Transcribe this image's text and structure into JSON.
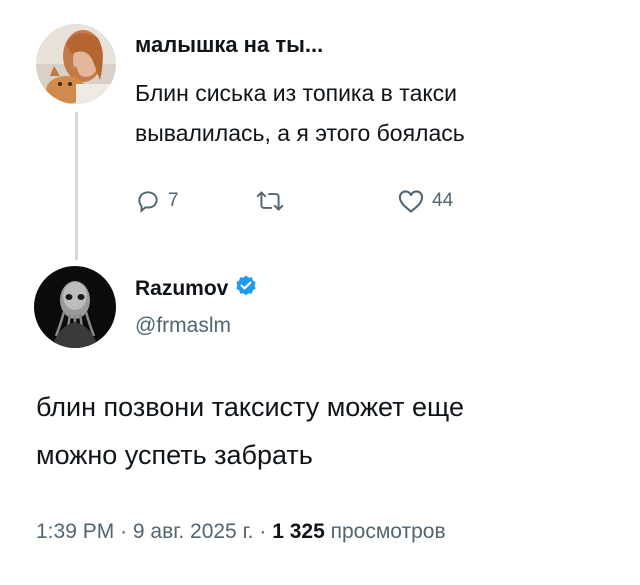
{
  "original_tweet": {
    "author_name": "малышка на ты...",
    "text_line1": "Блин сиська из топика в такси",
    "text_line2": "вывалилась, а я этого боялась",
    "reply_count": "7",
    "like_count": "44",
    "icons": {
      "reply": "reply-icon",
      "retweet": "retweet-icon",
      "like": "heart-icon"
    }
  },
  "reply_tweet": {
    "author_name": "Razumov",
    "handle": "@frmaslm",
    "verified": true,
    "text_line1": "блин позвони таксисту может еще",
    "text_line2": "можно успеть забрать",
    "time": "1:39 PM",
    "separator": "·",
    "date": "9 авг. 2025 г.",
    "views_count": "1 325",
    "views_label": "просмотров"
  },
  "colors": {
    "text": "#0f1419",
    "secondary": "#536471",
    "thread_line": "#cfd9de",
    "verified_badge": "#1d9bf0"
  }
}
